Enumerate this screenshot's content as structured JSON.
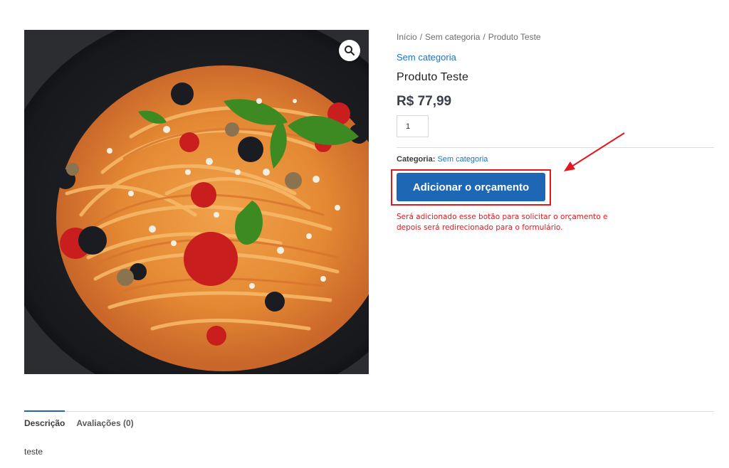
{
  "image": {
    "alt": "spaghetti dish",
    "zoom_icon": "magnifier-icon"
  },
  "breadcrumb": {
    "items": [
      "Início",
      "Sem categoria",
      "Produto Teste"
    ],
    "separator": "/"
  },
  "product": {
    "category_link": "Sem categoria",
    "title": "Produto Teste",
    "price": "R$ 77,99",
    "quantity": "1",
    "meta_label": "Categoria:",
    "meta_value": "Sem categoria",
    "quote_button": "Adicionar o orçamento",
    "note_line1": "Será adicionado esse botão para solicitar o orçamento e",
    "note_line2": "depois será redirecionado para o formulário."
  },
  "tabs": {
    "items": [
      "Descrição",
      "Avaliações (0)"
    ],
    "active": "Descrição",
    "content": "teste"
  },
  "colors": {
    "accent": "#1e67b5",
    "link": "#1e73be",
    "annotation": "#e0191f"
  }
}
